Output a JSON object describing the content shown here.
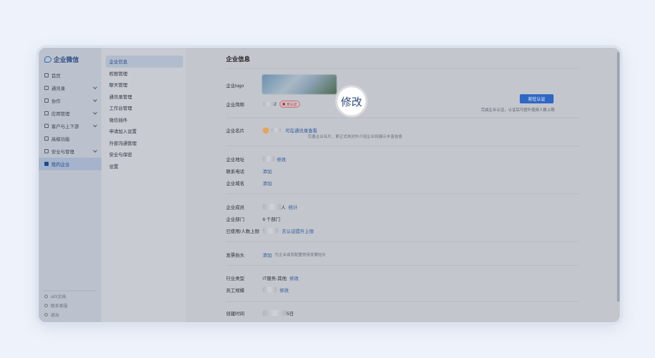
{
  "app": {
    "title": "企业微信"
  },
  "sidebar": {
    "items": [
      {
        "label": "首页",
        "icon": "home-icon",
        "chevron": false,
        "active": false
      },
      {
        "label": "通讯录",
        "icon": "contacts-icon",
        "chevron": true,
        "active": false
      },
      {
        "label": "协作",
        "icon": "collab-icon",
        "chevron": true,
        "active": false
      },
      {
        "label": "应用管理",
        "icon": "apps-icon",
        "chevron": true,
        "active": false
      },
      {
        "label": "客户与上下游",
        "icon": "customers-icon",
        "chevron": true,
        "active": false
      },
      {
        "label": "高级功能",
        "icon": "advanced-icon",
        "chevron": false,
        "active": false
      },
      {
        "label": "安全与管理",
        "icon": "security-icon",
        "chevron": true,
        "active": false
      },
      {
        "label": "我的企业",
        "icon": "company-icon",
        "chevron": false,
        "active": true
      }
    ],
    "bottom": [
      {
        "label": "API文档",
        "icon": "doc-icon"
      },
      {
        "label": "联系客服",
        "icon": "support-icon"
      },
      {
        "label": "退出",
        "icon": "logout-icon"
      }
    ]
  },
  "subnav": {
    "items": [
      "企业信息",
      "权限管理",
      "聊天管理",
      "通讯录管理",
      "工作台管理",
      "微信插件",
      "申请加入设置",
      "外部沟通管理",
      "安全与保密",
      "设置"
    ]
  },
  "main": {
    "title": "企业信息",
    "logo_label": "企业logo",
    "short_name_label": "企业简称",
    "short_name_suffix": "2",
    "badge": "未认证",
    "modify_bubble": "修改",
    "verify_button": "前往认证",
    "verify_tip": "完成企业认证，认证后可提升使用人数上限",
    "card_label": "企业名片",
    "card_link": "可在通讯录查看",
    "card_desc": "完善企业名片，更正式地对外介绍企业和展示丰富信息",
    "address_label": "企业地址",
    "address_link": "修改",
    "phone_label": "联系电话",
    "phone_link": "添加",
    "domain_label": "企业域名",
    "domain_link": "添加",
    "members_label": "企业成员",
    "members_suffix": "人",
    "members_link": "统计",
    "depts_label": "企业部门",
    "depts_value": "6 个部门",
    "limit_label": "已使用/人数上限",
    "limit_link": "去认证提升上限",
    "invoice_label": "发票抬头",
    "invoice_link": "添加",
    "invoice_desc": "为企业成员配置常用发票抬头",
    "industry_label": "行业类型",
    "industry_value": "IT服务-其他",
    "industry_link": "修改",
    "scale_label": "员工规模",
    "scale_link": "修改",
    "created_label": "创建时间",
    "created_suffix": "5日"
  }
}
